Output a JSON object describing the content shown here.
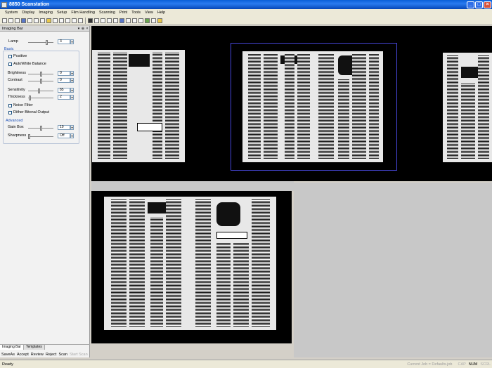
{
  "window": {
    "title": "8850 Scanstation"
  },
  "menu": [
    "System",
    "Display",
    "Imaging",
    "Setup",
    "Film Handling",
    "Scanning",
    "Print",
    "Tools",
    "View",
    "Help"
  ],
  "panel": {
    "title": "Imaging Bar",
    "lamp": {
      "label": "Lamp",
      "value": "3",
      "level": 0.72
    },
    "basic": {
      "title": "Basic",
      "positive": "Positive",
      "autowhite": "AutoWhite Balance",
      "brightness": {
        "label": "Brightness",
        "value": "0",
        "level": 0.5
      },
      "contrast": {
        "label": "Contrast",
        "value": "0",
        "level": 0.5
      },
      "sensitivity": {
        "label": "Sensitivity",
        "value": "85",
        "level": 0.42
      },
      "thickness": {
        "label": "Thickness",
        "value": "2",
        "level": 0.05
      },
      "noise": "Noise Filter",
      "dither": "Dither Bitonal Output"
    },
    "advanced": {
      "title": "Advanced",
      "gain": {
        "label": "Gain Box",
        "value": "10",
        "level": 0.48
      },
      "sharpness": {
        "label": "Sharpness",
        "value": "Off",
        "level": 0.0
      }
    },
    "tabs": [
      "Imaging Bar",
      "Templates"
    ],
    "buttons": [
      "SaveAs",
      "Accept",
      "Review",
      "Reject",
      "Scan"
    ],
    "disabled_button": "Start Scan"
  },
  "status": {
    "left": "Ready",
    "job": "Current Job = Defaults.job",
    "indicators": [
      "CAP",
      "NUM",
      "SCRL"
    ]
  }
}
